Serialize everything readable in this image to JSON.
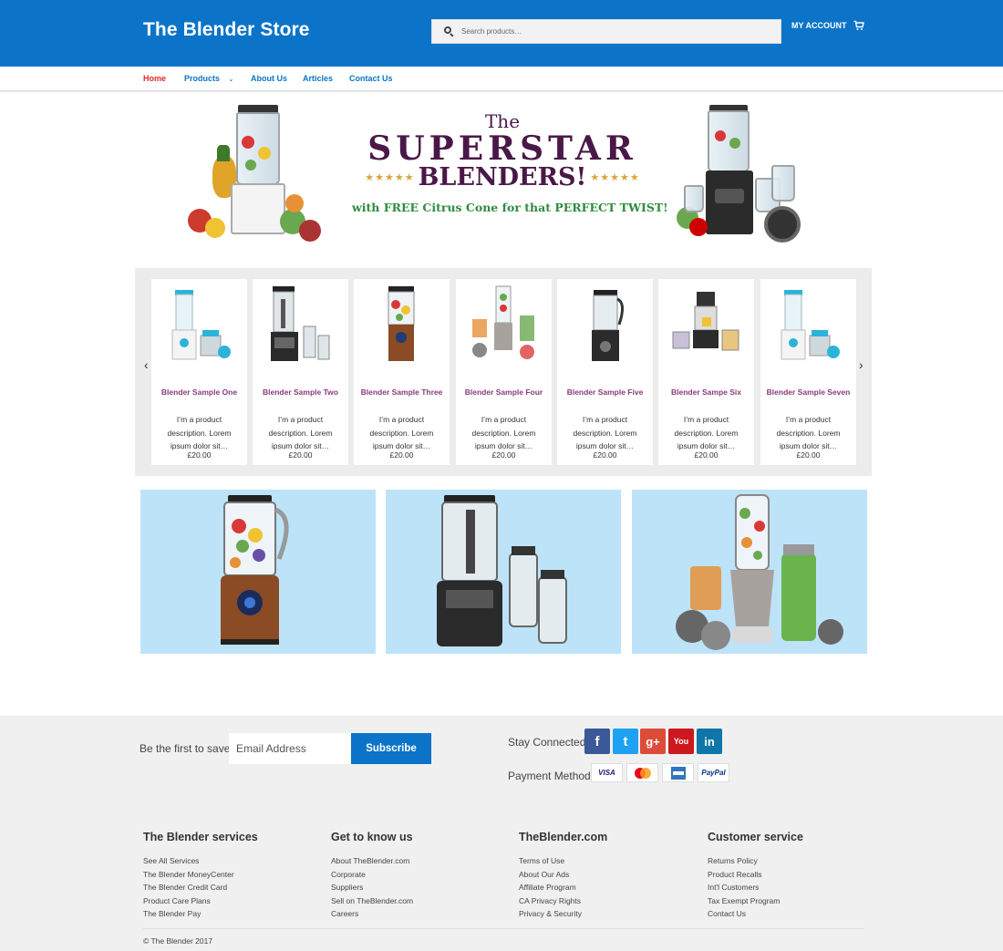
{
  "header": {
    "logo": "The Blender Store",
    "search_placeholder": "Search products…",
    "my_account": "MY ACCOUNT"
  },
  "nav": {
    "items": [
      {
        "label": "Home",
        "active": true
      },
      {
        "label": "Products",
        "has_dropdown": true
      },
      {
        "label": "About Us"
      },
      {
        "label": "Articles"
      },
      {
        "label": "Contact Us"
      }
    ]
  },
  "hero": {
    "line1": "The",
    "line2": "SUPERSTAR",
    "line3": "BLENDERS!",
    "stars": "★★★★★",
    "subline": "with FREE Citrus Cone for that PERFECT TWIST!"
  },
  "carousel": {
    "prev": "‹",
    "next": "›",
    "products": [
      {
        "name": "Blender Sample One",
        "desc": "I’m a product description. Lorem ipsum dolor sit…",
        "price": "£20.00"
      },
      {
        "name": "Blender Sample Two",
        "desc": "I’m a product description. Lorem ipsum dolor sit…",
        "price": "£20.00"
      },
      {
        "name": "Blender Sample Three",
        "desc": "I’m a product description. Lorem ipsum dolor sit…",
        "price": "£20.00"
      },
      {
        "name": "Blender Sample Four",
        "desc": "I’m a product description. Lorem ipsum dolor sit…",
        "price": "£20.00"
      },
      {
        "name": "Blender Sample Five",
        "desc": "I’m a product description. Lorem ipsum dolor sit…",
        "price": "£20.00"
      },
      {
        "name": "Blender Sampe Six",
        "desc": "I’m a product description. Lorem ipsum dolor sit…",
        "price": "£20.00"
      },
      {
        "name": "Blender Sample Seven",
        "desc": "I’m a product description. Lorem ipsum dolor sit…",
        "price": "£20.00"
      }
    ]
  },
  "footer": {
    "newsletter_label": "Be the first to save!",
    "email_placeholder": "Email Address",
    "subscribe": "Subscribe",
    "stay_connected": "Stay Connected",
    "social": [
      {
        "icon": "facebook-icon",
        "glyph": "f",
        "color": "#3b5998"
      },
      {
        "icon": "twitter-icon",
        "glyph": "t",
        "color": "#1da1f2"
      },
      {
        "icon": "google-plus-icon",
        "glyph": "g+",
        "color": "#dd4b39"
      },
      {
        "icon": "youtube-icon",
        "glyph": "You",
        "color": "#cc181e"
      },
      {
        "icon": "linkedin-icon",
        "glyph": "in",
        "color": "#0e76a8"
      }
    ],
    "payment_label": "Payment Method",
    "payments": [
      "VISA",
      "MC",
      "AMEX",
      "PayPal"
    ],
    "columns": [
      {
        "title": "The Blender services",
        "links": [
          "See All Services",
          "The Blender MoneyCenter",
          "The Blender Credit Card",
          "Product Care Plans",
          "The Blender Pay"
        ]
      },
      {
        "title": "Get to know us",
        "links": [
          "About TheBlender.com",
          "Corporate",
          "Suppliers",
          "Sell on TheBlender.com",
          "Careers"
        ]
      },
      {
        "title": "TheBlender.com",
        "links": [
          "Terms of Use",
          "About Our Ads",
          "Affiliate Program",
          "CA Privacy Rights",
          "Privacy & Security"
        ]
      },
      {
        "title": "Customer service",
        "links": [
          "Returns Policy",
          "Product Recalls",
          "Int'l Customers",
          "Tax Exempt Program",
          "Contact Us"
        ]
      }
    ],
    "copyright": "© The Blender 2017"
  },
  "colors": {
    "brand_blue": "#0b74c8",
    "active_nav": "#e0292e",
    "product_title": "#8a3a7c",
    "tile_bg": "#bde3f8"
  }
}
